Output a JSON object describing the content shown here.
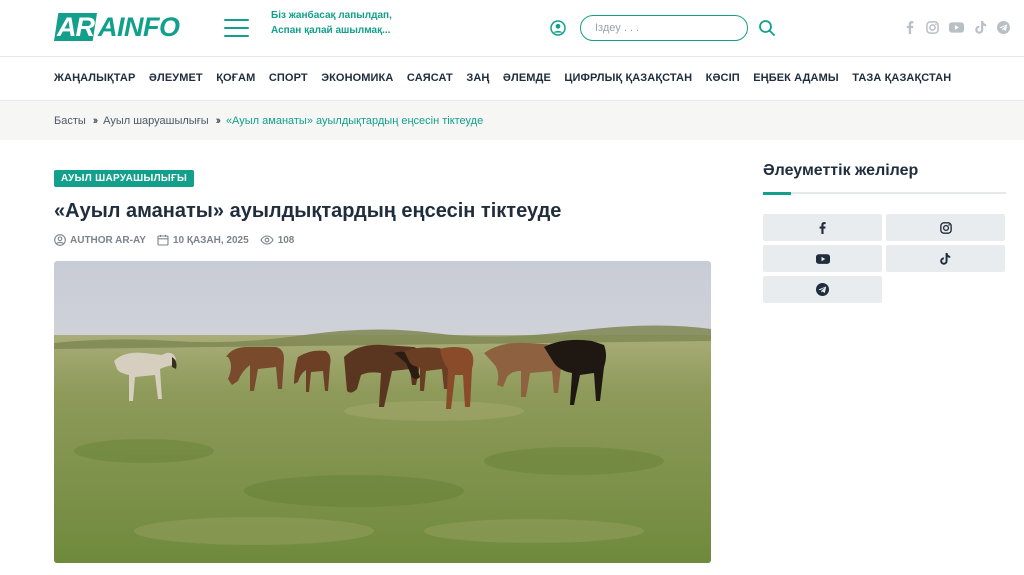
{
  "header": {
    "logo": "ARAINFO",
    "logo_parts": [
      "AR",
      "AINFO"
    ],
    "slogan_line1": "Біз жанбасақ лапылдап,",
    "slogan_line2": "Аспан қалай ашылмақ...",
    "search_placeholder": "Іздеу . . .",
    "social_icons": [
      "facebook-icon",
      "instagram-icon",
      "youtube-icon",
      "tiktok-icon",
      "telegram-icon"
    ]
  },
  "nav": {
    "items": [
      "ЖАҢАЛЫҚТАР",
      "ӘЛЕУМЕТ",
      "ҚОҒАМ",
      "СПОРТ",
      "ЭКОНОМИКА",
      "САЯСАТ",
      "ЗАҢ",
      "ӘЛЕМДЕ",
      "ЦИФРЛЫҚ ҚАЗАҚСТАН",
      "КӘСІП",
      "ЕҢБЕК АДАМЫ",
      "ТАЗА ҚАЗАҚСТАН"
    ]
  },
  "breadcrumb": {
    "home": "Басты",
    "category": "Ауыл шаруашылығы",
    "current": "«Ауыл аманаты» ауылдықтардың еңсесін тіктеуде"
  },
  "article": {
    "category": "АУЫЛ ШАРУАШЫЛЫҒЫ",
    "title": "«Ауыл аманаты» ауылдықтардың еңсесін тіктеуде",
    "author": "AUTHOR AR-AY",
    "date": "10 ҚАЗАН, 2025",
    "views": "108"
  },
  "sidebar": {
    "title": "Әлеуметтік желілер",
    "social_buttons": [
      "facebook-icon",
      "instagram-icon",
      "youtube-icon",
      "tiktok-icon",
      "telegram-icon"
    ]
  },
  "colors": {
    "accent": "#12a08c",
    "text": "#1f2d3d",
    "muted": "#7a838c",
    "breadcrumb_bg": "#f6f6f4",
    "social_bg": "#e9ecef"
  }
}
